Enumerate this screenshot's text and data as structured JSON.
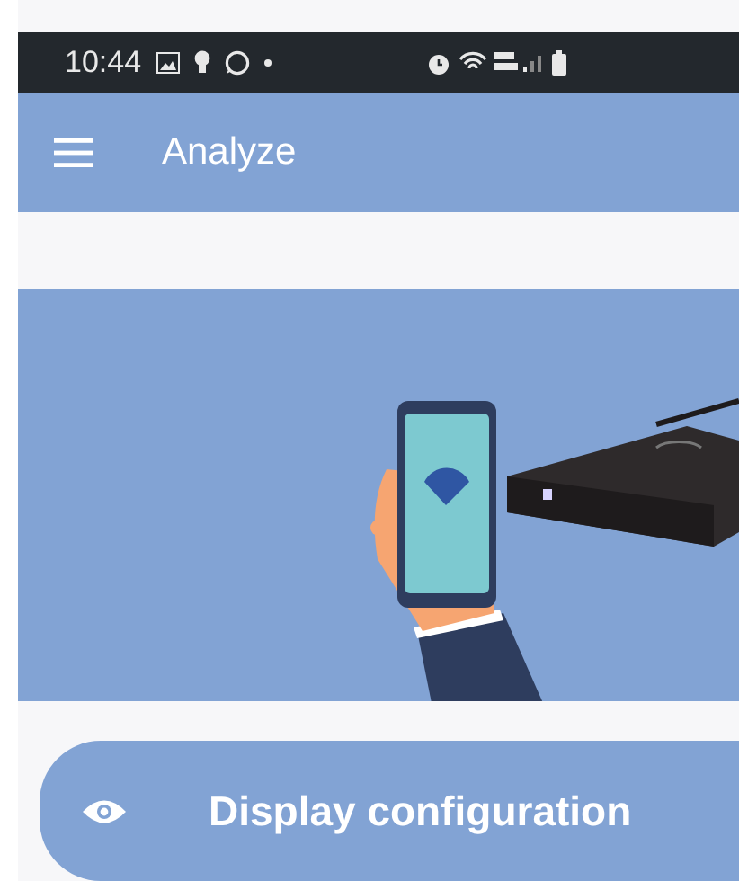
{
  "status_bar": {
    "time": "10:44"
  },
  "app_bar": {
    "title": "Analyze"
  },
  "action_button": {
    "label": "Display configuration"
  }
}
